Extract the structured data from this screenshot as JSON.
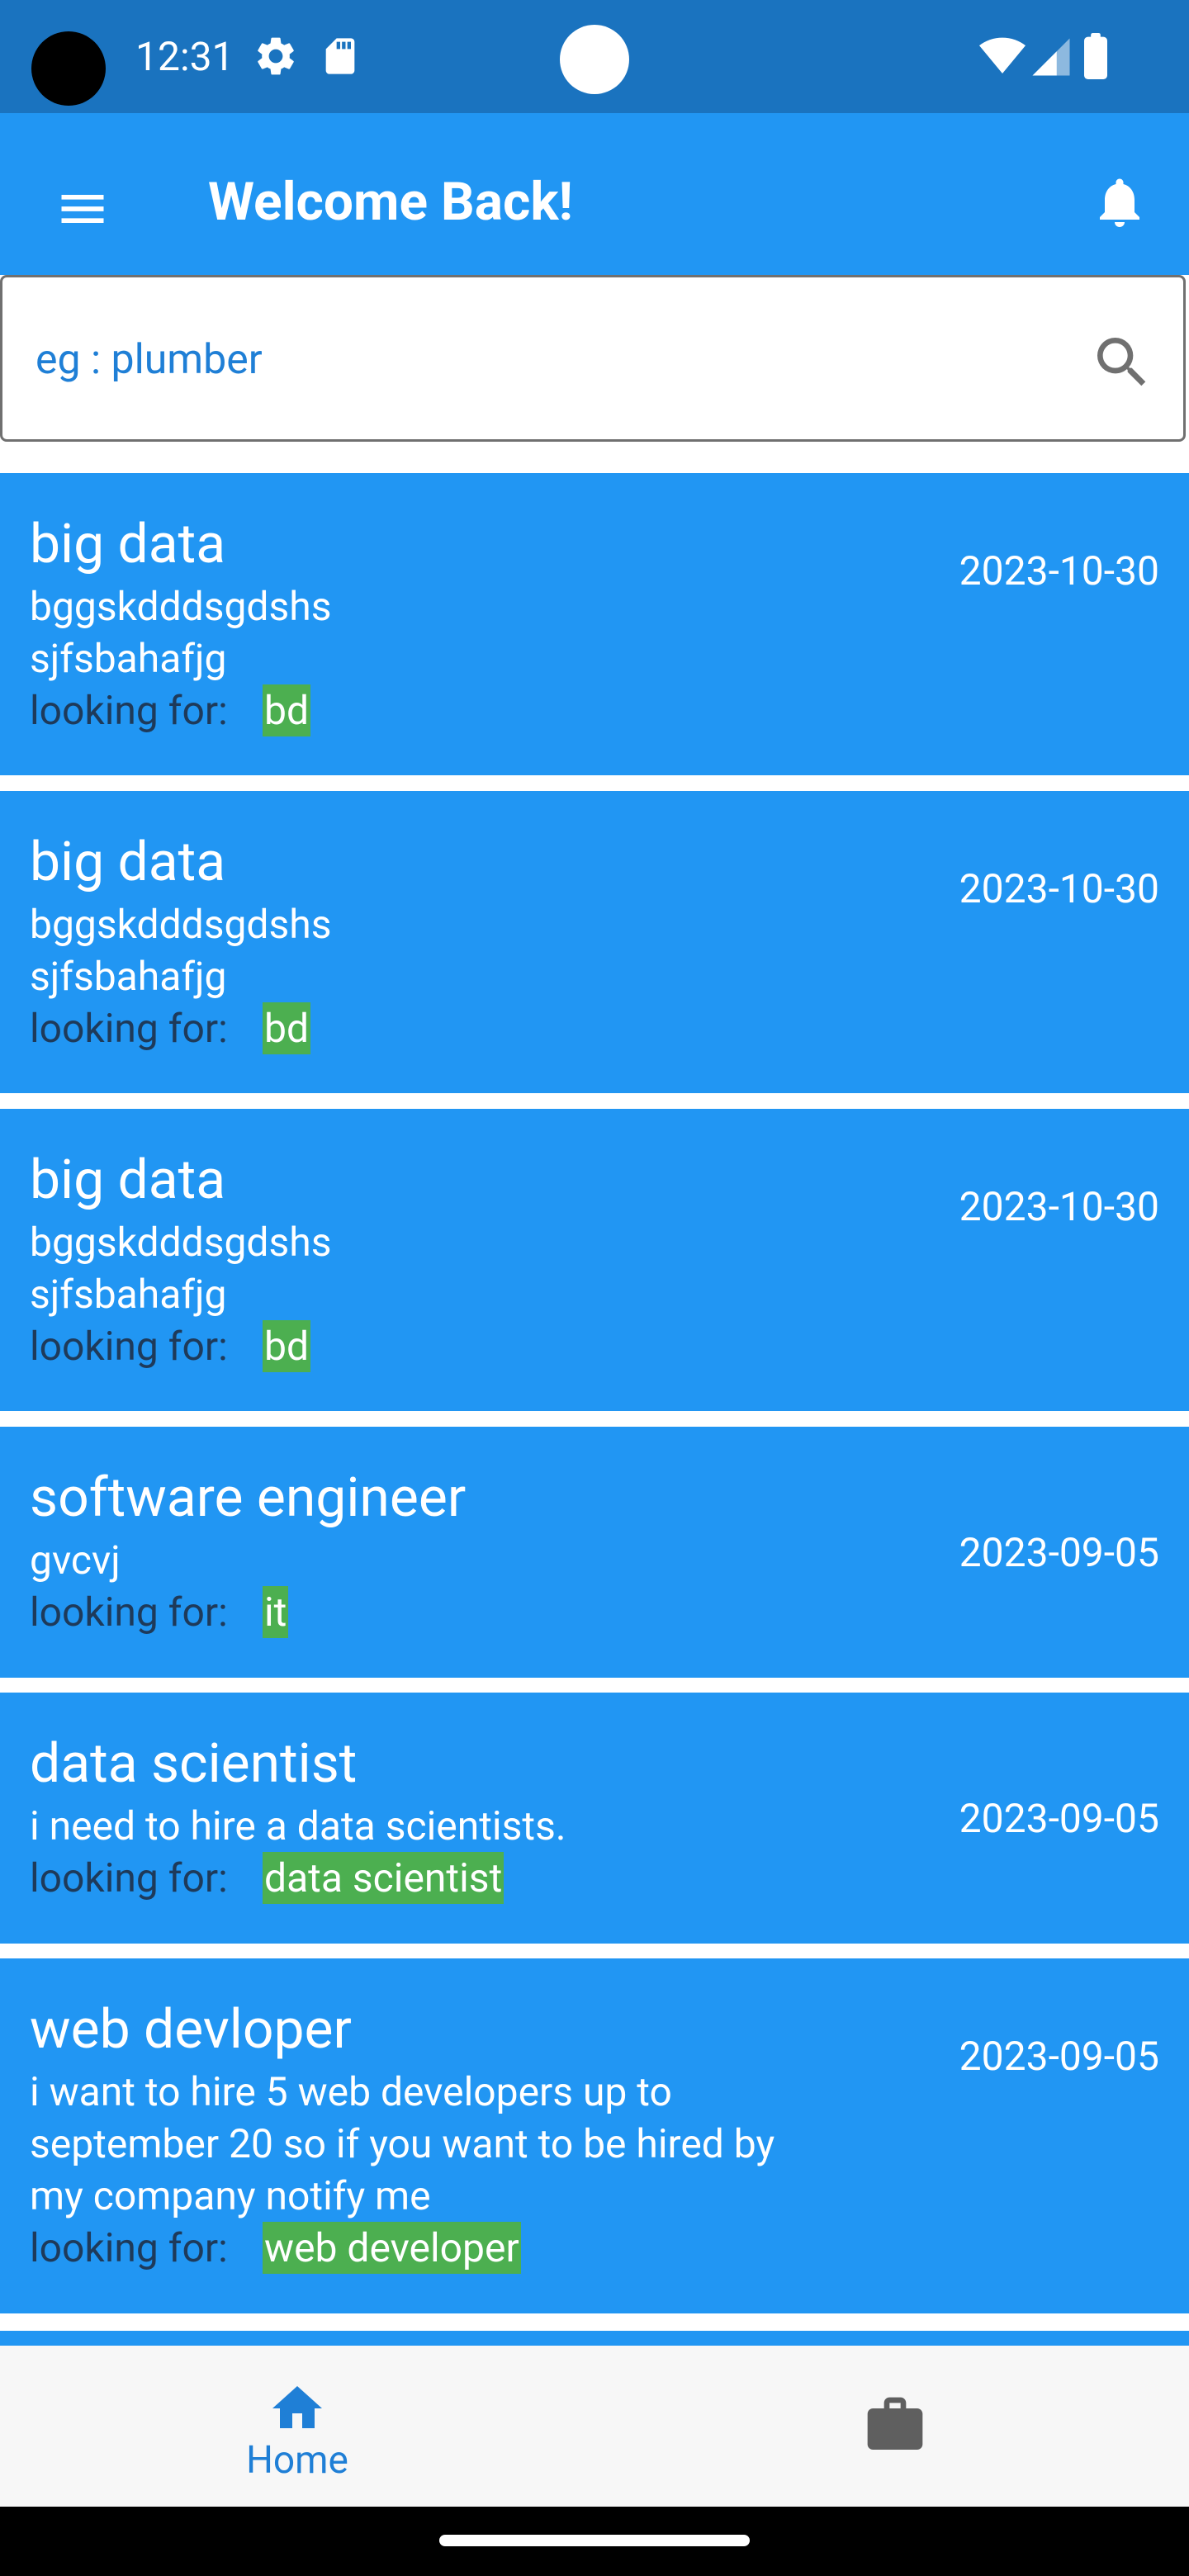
{
  "status_bar": {
    "time": "12:31",
    "icons": [
      "settings-icon",
      "sd-card-icon",
      "wifi-icon",
      "signal-icon",
      "battery-icon"
    ]
  },
  "app_bar": {
    "title": "Welcome Back!",
    "menu_icon": "menu-icon",
    "notification_icon": "bell-icon"
  },
  "search": {
    "placeholder": "eg : plumber",
    "value": ""
  },
  "jobs": [
    {
      "title": "big data",
      "description": [
        "bggskdddsgdshs",
        "sjfsbahafjg"
      ],
      "looking_label": "looking for:",
      "tag": "bd",
      "date": "2023-10-30"
    },
    {
      "title": "big data",
      "description": [
        "bggskdddsgdshs",
        "sjfsbahafjg"
      ],
      "looking_label": "looking for:",
      "tag": "bd",
      "date": "2023-10-30"
    },
    {
      "title": "big data",
      "description": [
        "bggskdddsgdshs",
        "sjfsbahafjg"
      ],
      "looking_label": "looking for:",
      "tag": "bd",
      "date": "2023-10-30"
    },
    {
      "title": "software engineer",
      "description": [
        "gvcvj"
      ],
      "looking_label": "looking for:",
      "tag": "it",
      "date": "2023-09-05"
    },
    {
      "title": "data scientist",
      "description": [
        "i need to hire a data scientists."
      ],
      "looking_label": "looking for:",
      "tag": "data scientist",
      "date": "2023-09-05"
    },
    {
      "title": "web devloper",
      "description": [
        "i want to hire 5 web developers up to",
        "september 20 so if you want to be hired by",
        "my company notify me"
      ],
      "looking_label": "looking for:",
      "tag": "web developer",
      "date": "2023-09-05"
    }
  ],
  "bottom_nav": {
    "items": [
      {
        "label": "Home",
        "icon": "home-icon",
        "active": true
      },
      {
        "label": "",
        "icon": "briefcase-icon",
        "active": false
      }
    ]
  },
  "colors": {
    "status_bar": "#1a73bf",
    "primary": "#2196f3",
    "tag": "#4caf50",
    "nav_active": "#1f7fd6",
    "nav_inactive": "#5f5f5f"
  }
}
